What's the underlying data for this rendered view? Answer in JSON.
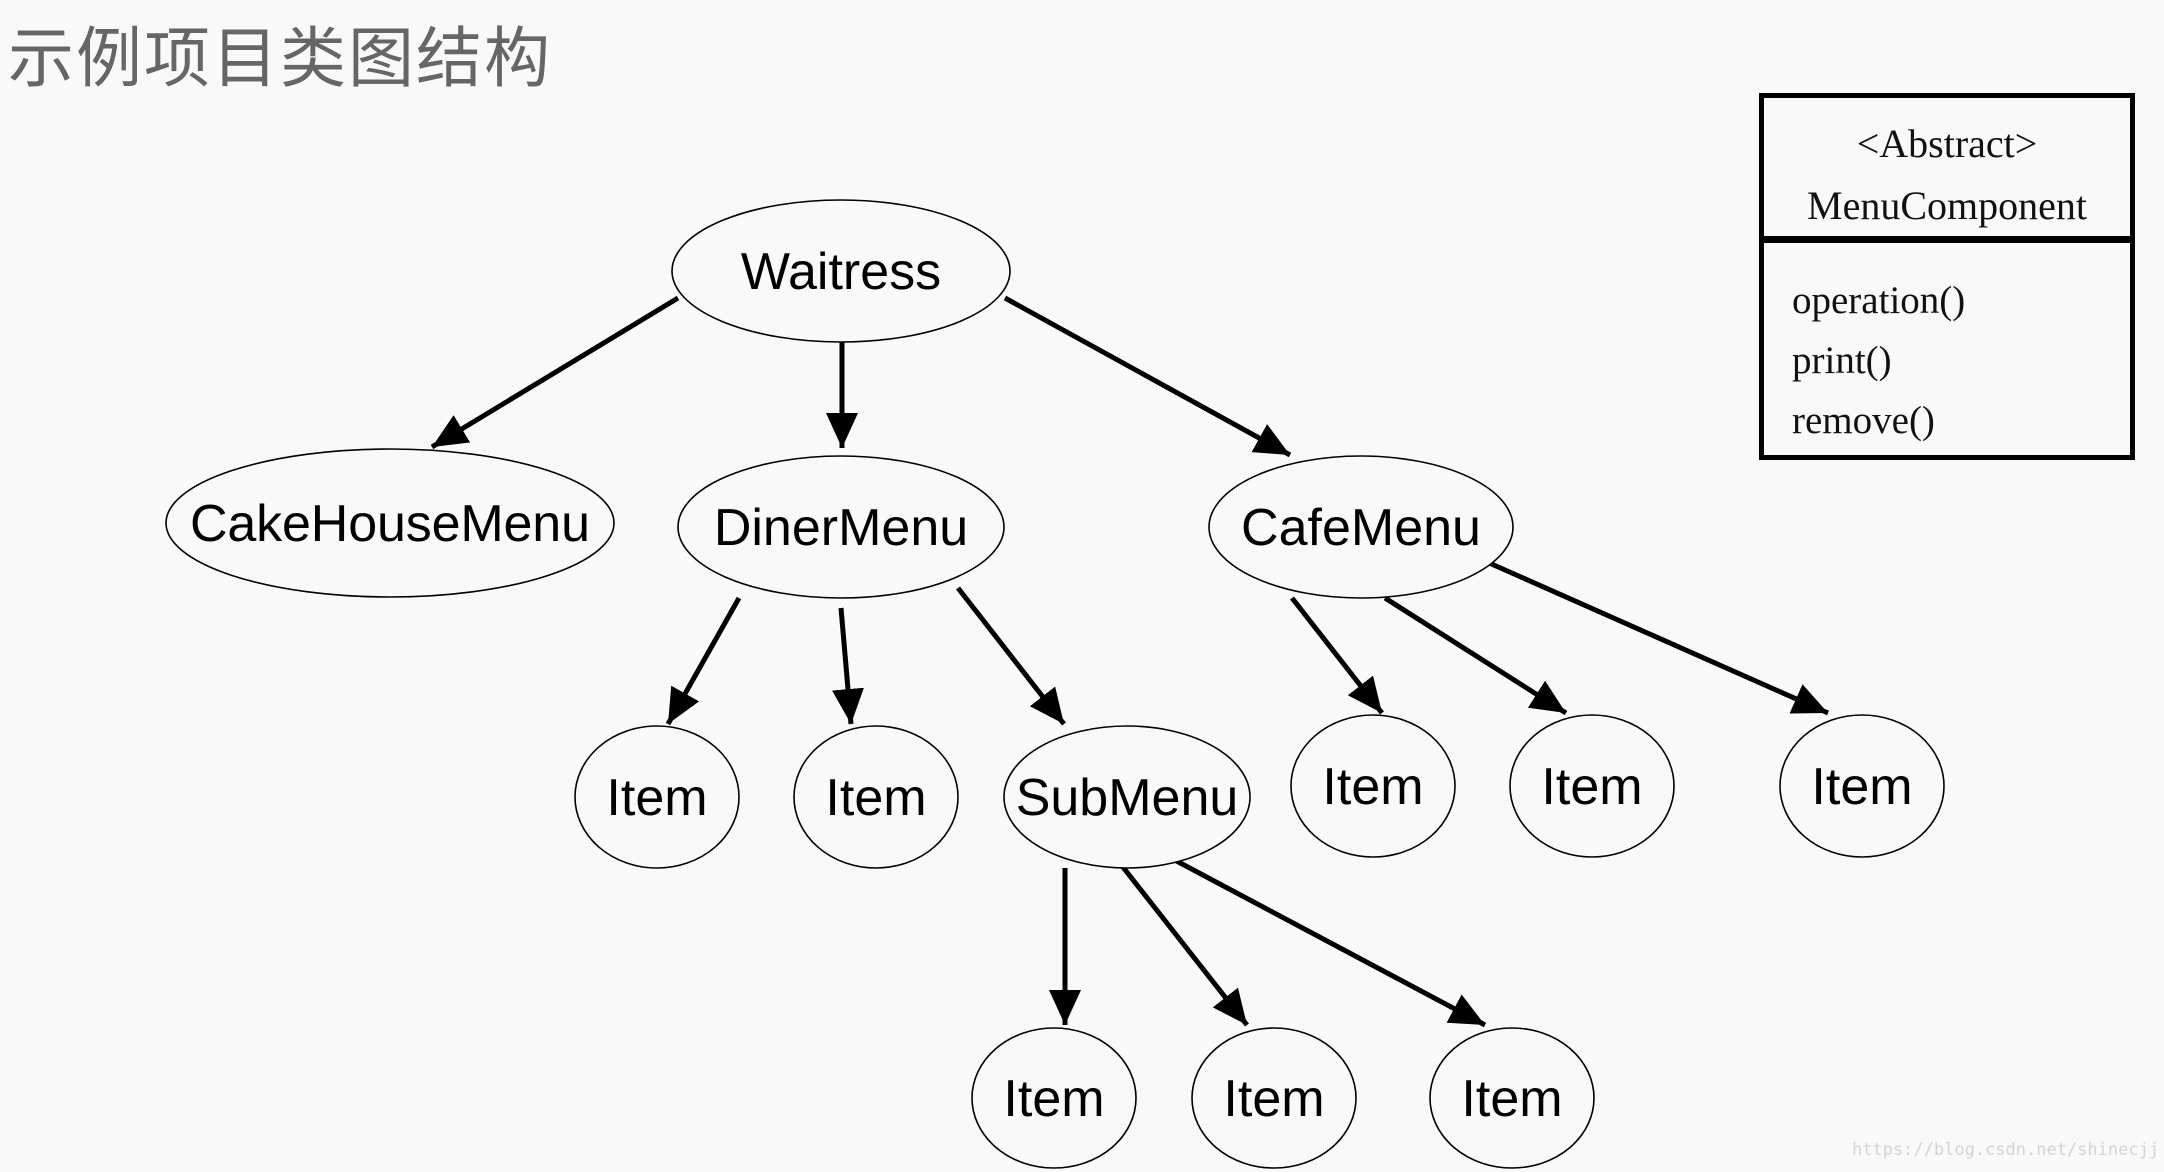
{
  "page": {
    "title": "示例项目类图结构",
    "watermark": "https://blog.csdn.net/shinecjj"
  },
  "diagram": {
    "nodes": [
      {
        "id": "waitress",
        "label": "Waitress"
      },
      {
        "id": "cakehousemenu",
        "label": "CakeHouseMenu"
      },
      {
        "id": "dinermenu",
        "label": "DinerMenu"
      },
      {
        "id": "cafemenu",
        "label": "CafeMenu"
      },
      {
        "id": "diner-item-1",
        "label": "Item"
      },
      {
        "id": "diner-item-2",
        "label": "Item"
      },
      {
        "id": "submenu",
        "label": "SubMenu"
      },
      {
        "id": "cafe-item-1",
        "label": "Item"
      },
      {
        "id": "cafe-item-2",
        "label": "Item"
      },
      {
        "id": "cafe-item-3",
        "label": "Item"
      },
      {
        "id": "sub-item-1",
        "label": "Item"
      },
      {
        "id": "sub-item-2",
        "label": "Item"
      },
      {
        "id": "sub-item-3",
        "label": "Item"
      }
    ],
    "edges": [
      {
        "from": "waitress",
        "to": "cakehousemenu"
      },
      {
        "from": "waitress",
        "to": "dinermenu"
      },
      {
        "from": "waitress",
        "to": "cafemenu"
      },
      {
        "from": "dinermenu",
        "to": "diner-item-1"
      },
      {
        "from": "dinermenu",
        "to": "diner-item-2"
      },
      {
        "from": "dinermenu",
        "to": "submenu"
      },
      {
        "from": "cafemenu",
        "to": "cafe-item-1"
      },
      {
        "from": "cafemenu",
        "to": "cafe-item-2"
      },
      {
        "from": "cafemenu",
        "to": "cafe-item-3"
      },
      {
        "from": "submenu",
        "to": "sub-item-1"
      },
      {
        "from": "submenu",
        "to": "sub-item-2"
      },
      {
        "from": "submenu",
        "to": "sub-item-3"
      }
    ]
  },
  "uml": {
    "stereotype": "<Abstract>",
    "class_name": "MenuComponent",
    "methods": [
      "operation()",
      "print()",
      "remove()"
    ]
  }
}
